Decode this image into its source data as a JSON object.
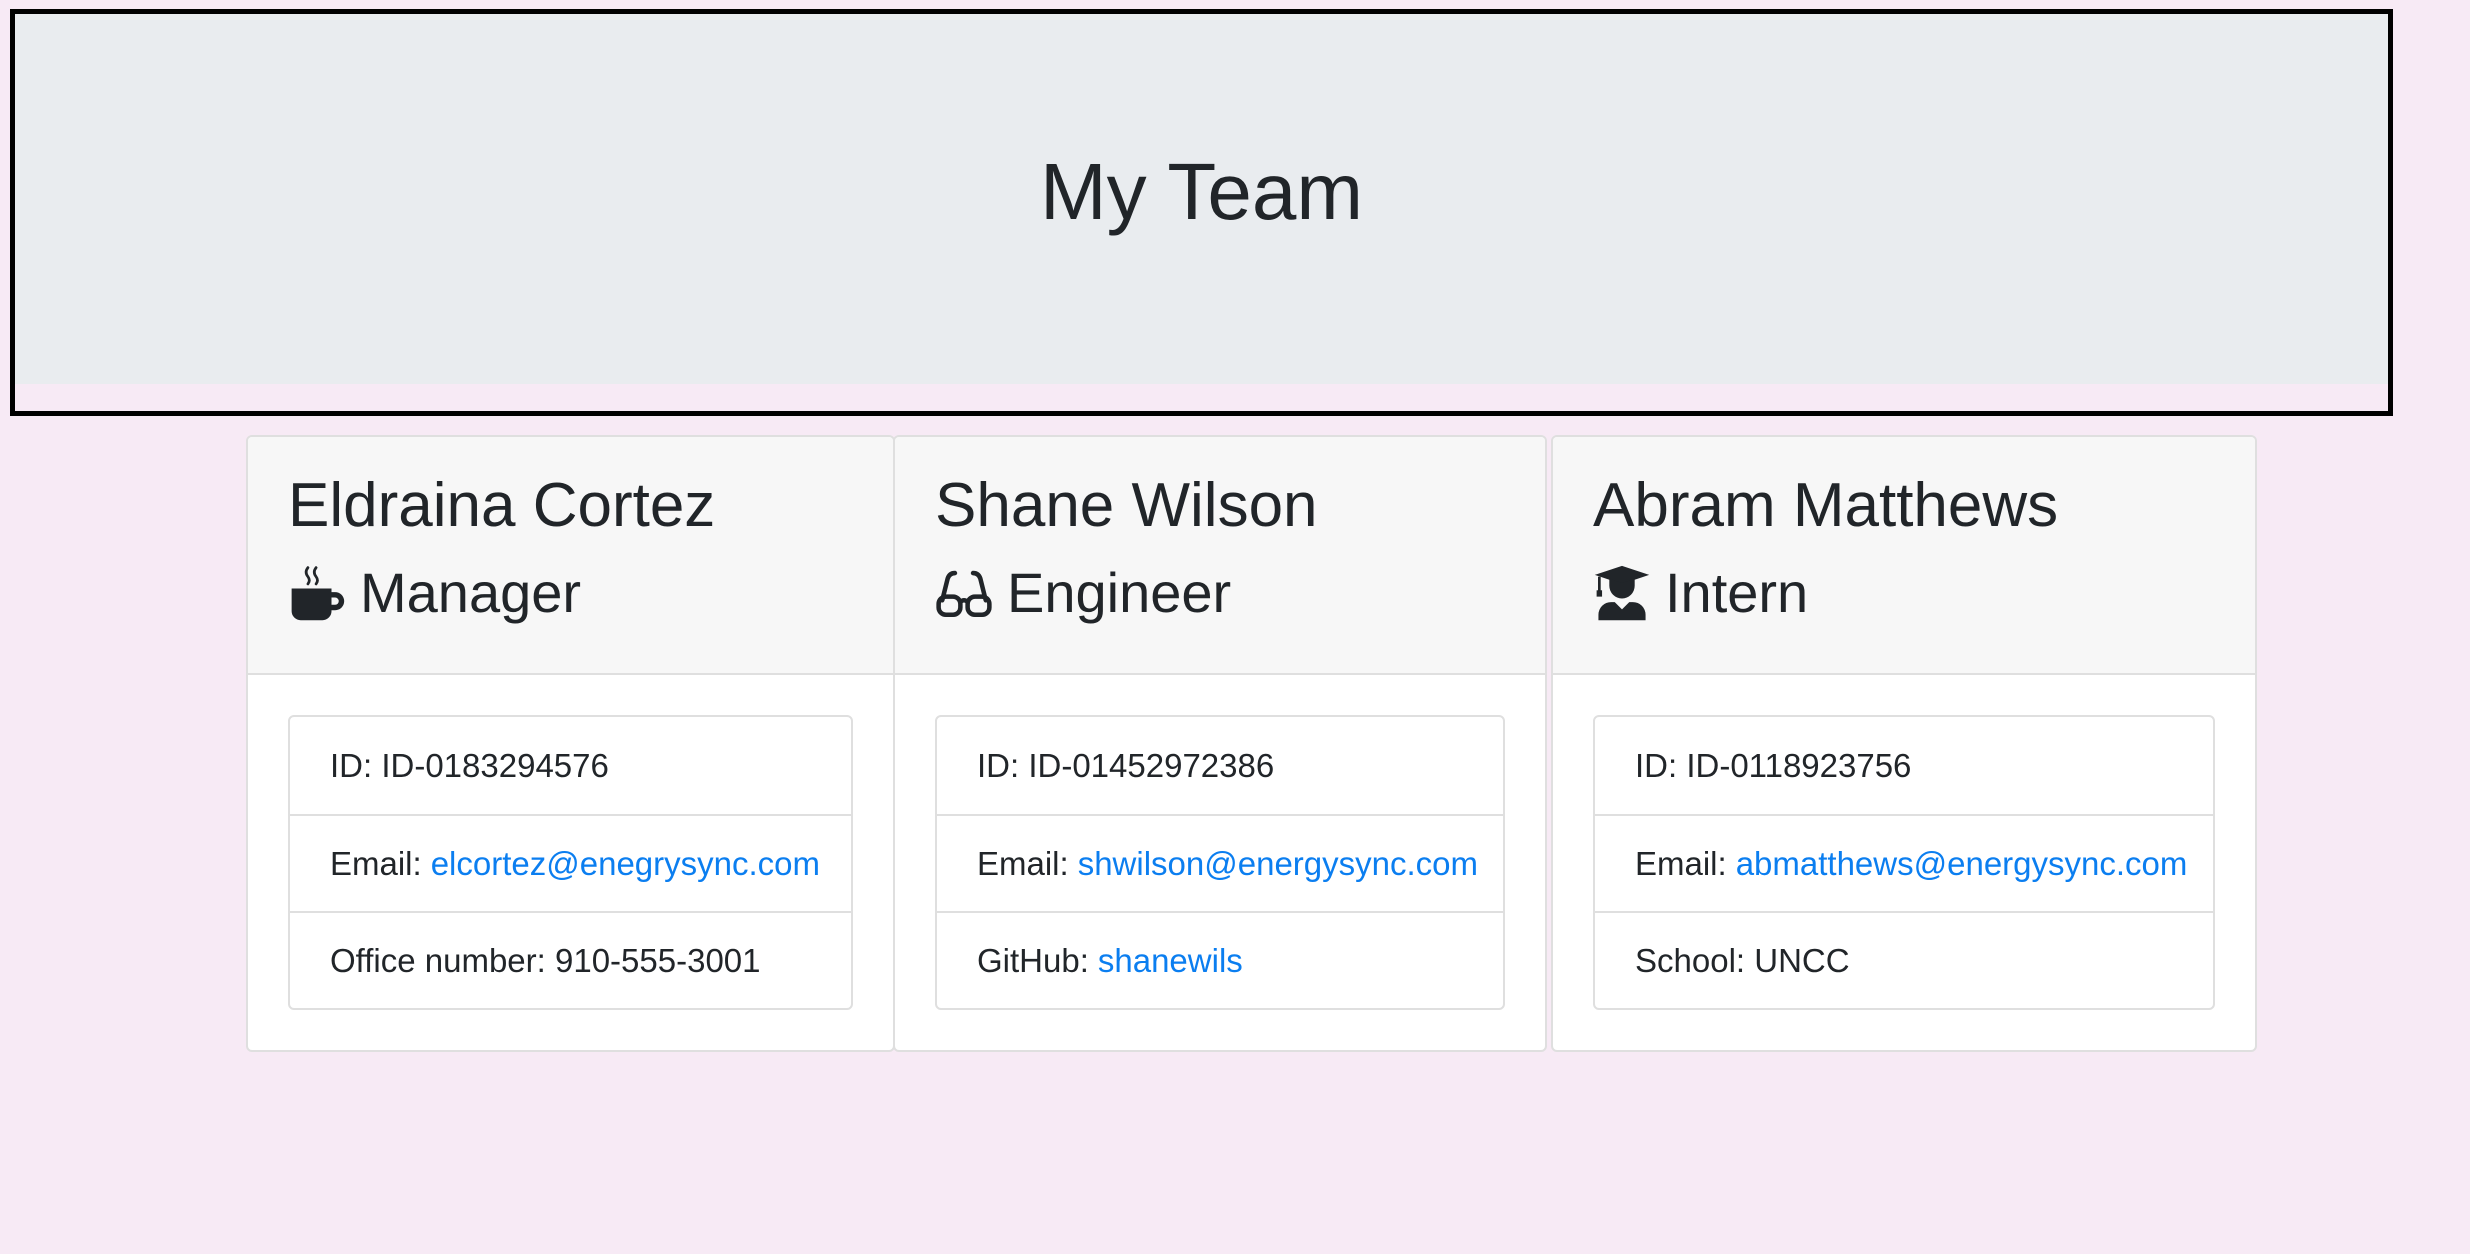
{
  "header": {
    "title": "My Team"
  },
  "team": [
    {
      "name": "Eldraina Cortez",
      "role": "Manager",
      "role_icon": "coffee-mug-icon",
      "id_label": "ID:",
      "id_value": "ID-0183294576",
      "email_label": "Email:",
      "email_value": "elcortez@enegrysync.com",
      "extra_label": "Office number:",
      "extra_value": "910-555-3001"
    },
    {
      "name": "Shane Wilson",
      "role": "Engineer",
      "role_icon": "glasses-icon",
      "id_label": "ID:",
      "id_value": "ID-01452972386",
      "email_label": "Email:",
      "email_value": "shwilson@energysync.com",
      "extra_label": "GitHub:",
      "extra_value": "shanewils"
    },
    {
      "name": "Abram Matthews",
      "role": "Intern",
      "role_icon": "graduate-icon",
      "id_label": "ID:",
      "id_value": "ID-0118923756",
      "email_label": "Email:",
      "email_value": "abmatthews@energysync.com",
      "extra_label": "School:",
      "extra_value": "UNCC"
    }
  ],
  "colors": {
    "page_background": "#f7eaf5",
    "jumbotron_background": "#e9ecef",
    "card_header_background": "#f7f7f7",
    "link": "#0b7ef0",
    "text": "#212529"
  }
}
